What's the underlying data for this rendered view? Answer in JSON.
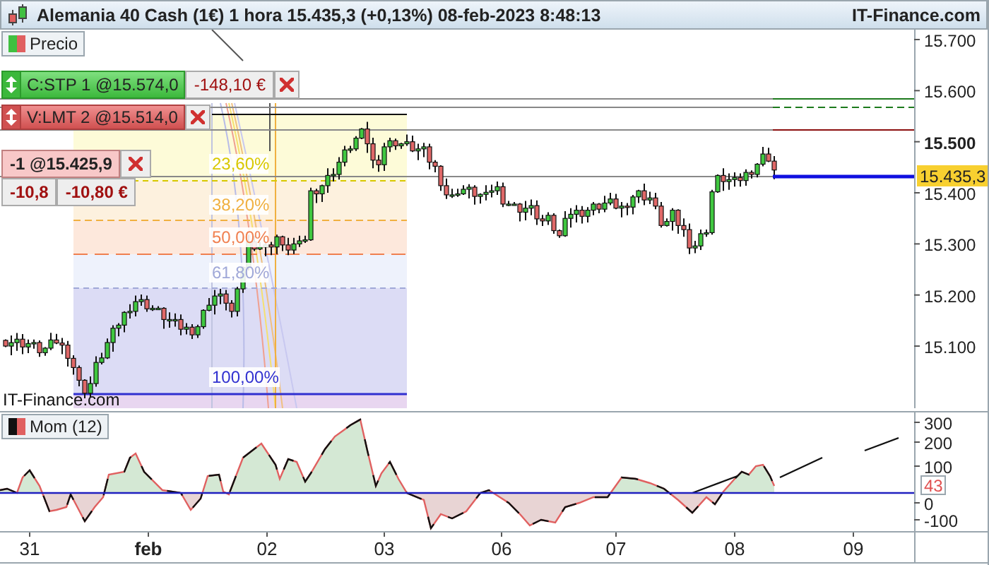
{
  "window": {
    "title": "Alemania 40 Cash (1€) 1 hora 15.435,3 (+0,13%) 08-feb-2023 8:48:13",
    "brand": "IT-Finance.com"
  },
  "price_panel": {
    "legend": "Precio",
    "watermark": "IT-Finance.com",
    "last_price": "15.435,3",
    "y_ticks": [
      {
        "label": "15.700",
        "bold": false
      },
      {
        "label": "15.600",
        "bold": false
      },
      {
        "label": "15.500",
        "bold": true
      },
      {
        "label": "15.400",
        "bold": false
      },
      {
        "label": "15.300",
        "bold": false
      },
      {
        "label": "15.200",
        "bold": false
      },
      {
        "label": "15.100",
        "bold": false
      }
    ],
    "fibonacci": [
      {
        "label": "23,60%",
        "color": "#d8c800"
      },
      {
        "label": "38,20%",
        "color": "#f0b040"
      },
      {
        "label": "50,00%",
        "color": "#f08050"
      },
      {
        "label": "61,80%",
        "color": "#a0a8d8"
      },
      {
        "label": "100,00%",
        "color": "#3030d0"
      }
    ],
    "orders": [
      {
        "kind": "stop",
        "label": "C:STP 1 @15.574,0",
        "pnl": "-148,10 €"
      },
      {
        "kind": "limit",
        "label": "V:LMT 2 @15.514,0"
      }
    ],
    "position": {
      "label": "-1 @15.425,9",
      "points": "-10,8",
      "pnl": "-10,80 €"
    }
  },
  "indicator": {
    "legend": "Mom (12)",
    "value": "43",
    "y_ticks": [
      "300",
      "200",
      "100",
      "0",
      "-100"
    ]
  },
  "x_axis": [
    {
      "label": "31",
      "bold": false
    },
    {
      "label": "feb",
      "bold": true
    },
    {
      "label": "02",
      "bold": false
    },
    {
      "label": "03",
      "bold": false
    },
    {
      "label": "06",
      "bold": false
    },
    {
      "label": "07",
      "bold": false
    },
    {
      "label": "08",
      "bold": false
    },
    {
      "label": "09",
      "bold": false
    }
  ]
}
